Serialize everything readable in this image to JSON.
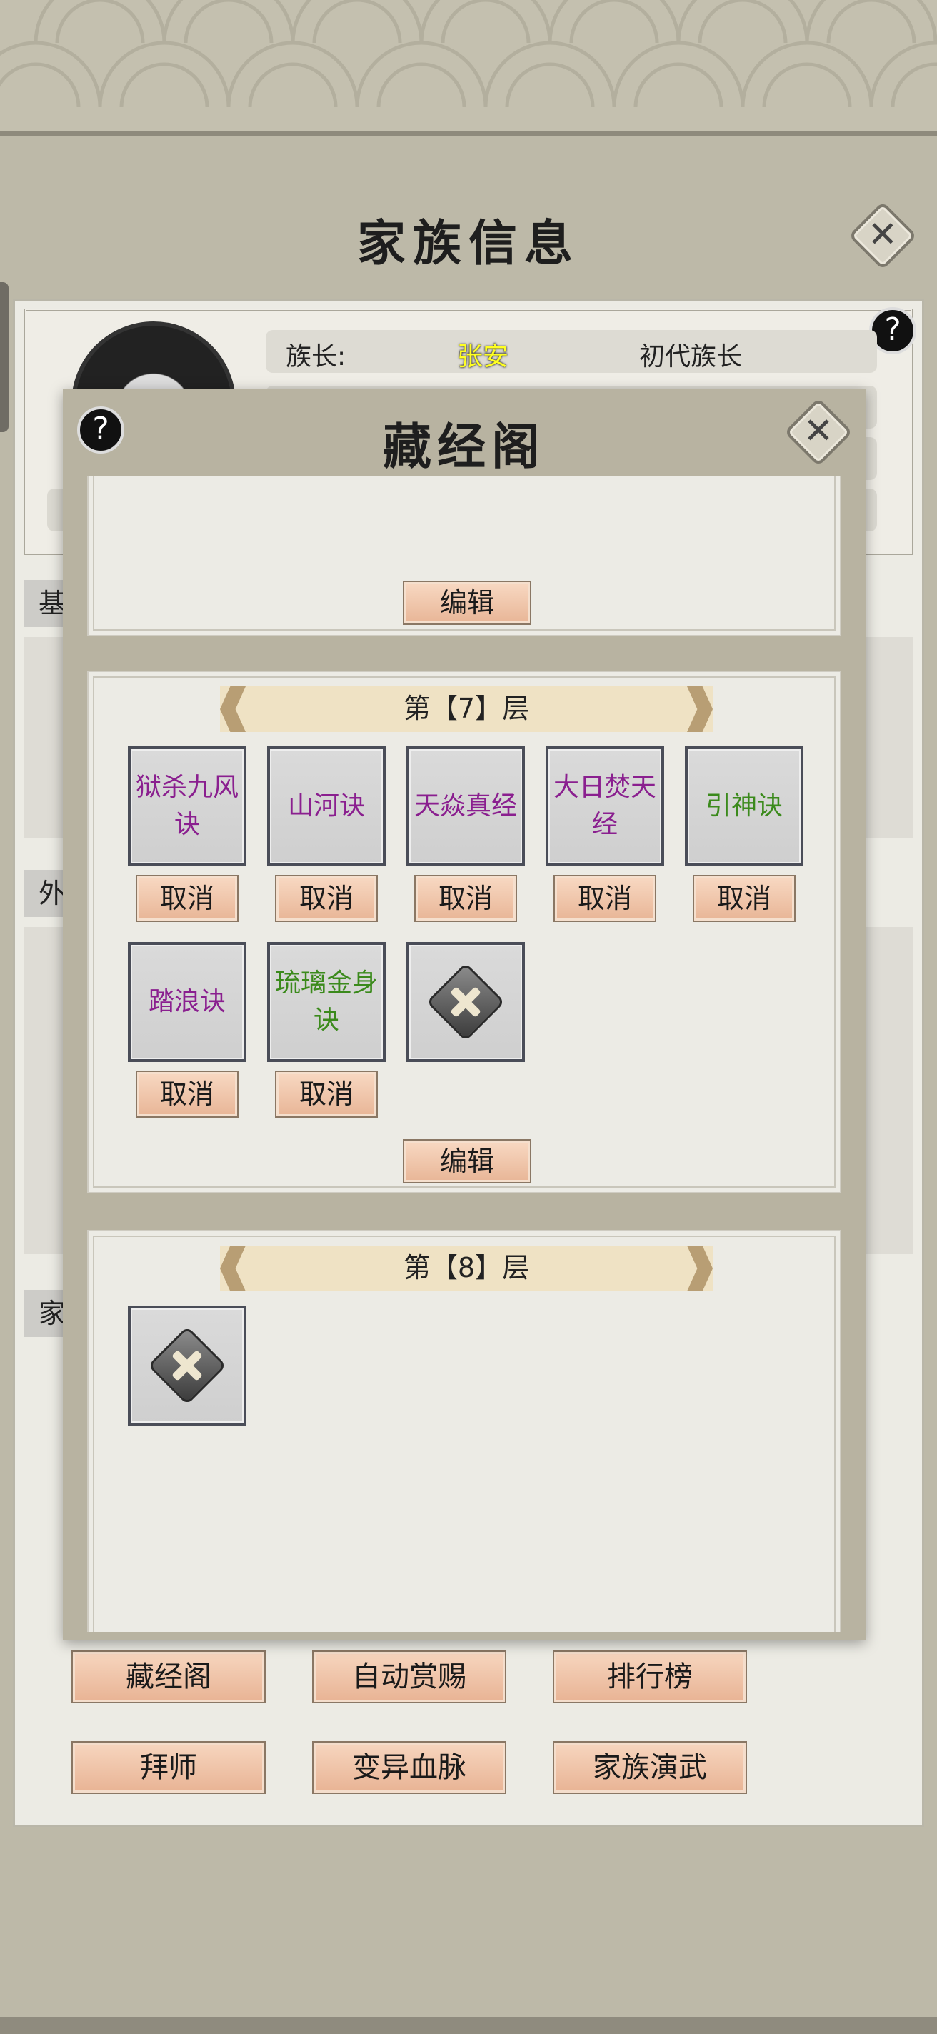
{
  "family_window": {
    "title": "家族信息",
    "leader_label": "族长:",
    "leader_name": "张安",
    "leader_rank": "初代族长",
    "side_tabs": [
      "基",
      "外",
      "家"
    ]
  },
  "bottom_buttons": {
    "row1": [
      "藏经阁",
      "自动赏赐",
      "排行榜"
    ],
    "row2": [
      "拜师",
      "变异血脉",
      "家族演武"
    ]
  },
  "library": {
    "title": "藏经阁",
    "help_symbol": "?",
    "close_symbol": "✕",
    "edit_label": "编辑",
    "cancel_label": "取消",
    "floors": [
      {
        "header": "第【7】层",
        "skills": [
          {
            "name": "狱杀九风诀",
            "color": "#8a1f8f"
          },
          {
            "name": "山河诀",
            "color": "#8a1f8f"
          },
          {
            "name": "天焱真经",
            "color": "#8a1f8f"
          },
          {
            "name": "大日焚天经",
            "color": "#8a1f8f"
          },
          {
            "name": "引神诀",
            "color": "#3b8a1c"
          },
          {
            "name": "踏浪诀",
            "color": "#8a1f8f"
          },
          {
            "name": "琉璃金身诀",
            "color": "#3b8a1c"
          }
        ]
      },
      {
        "header": "第【8】层",
        "skills": []
      }
    ]
  }
}
